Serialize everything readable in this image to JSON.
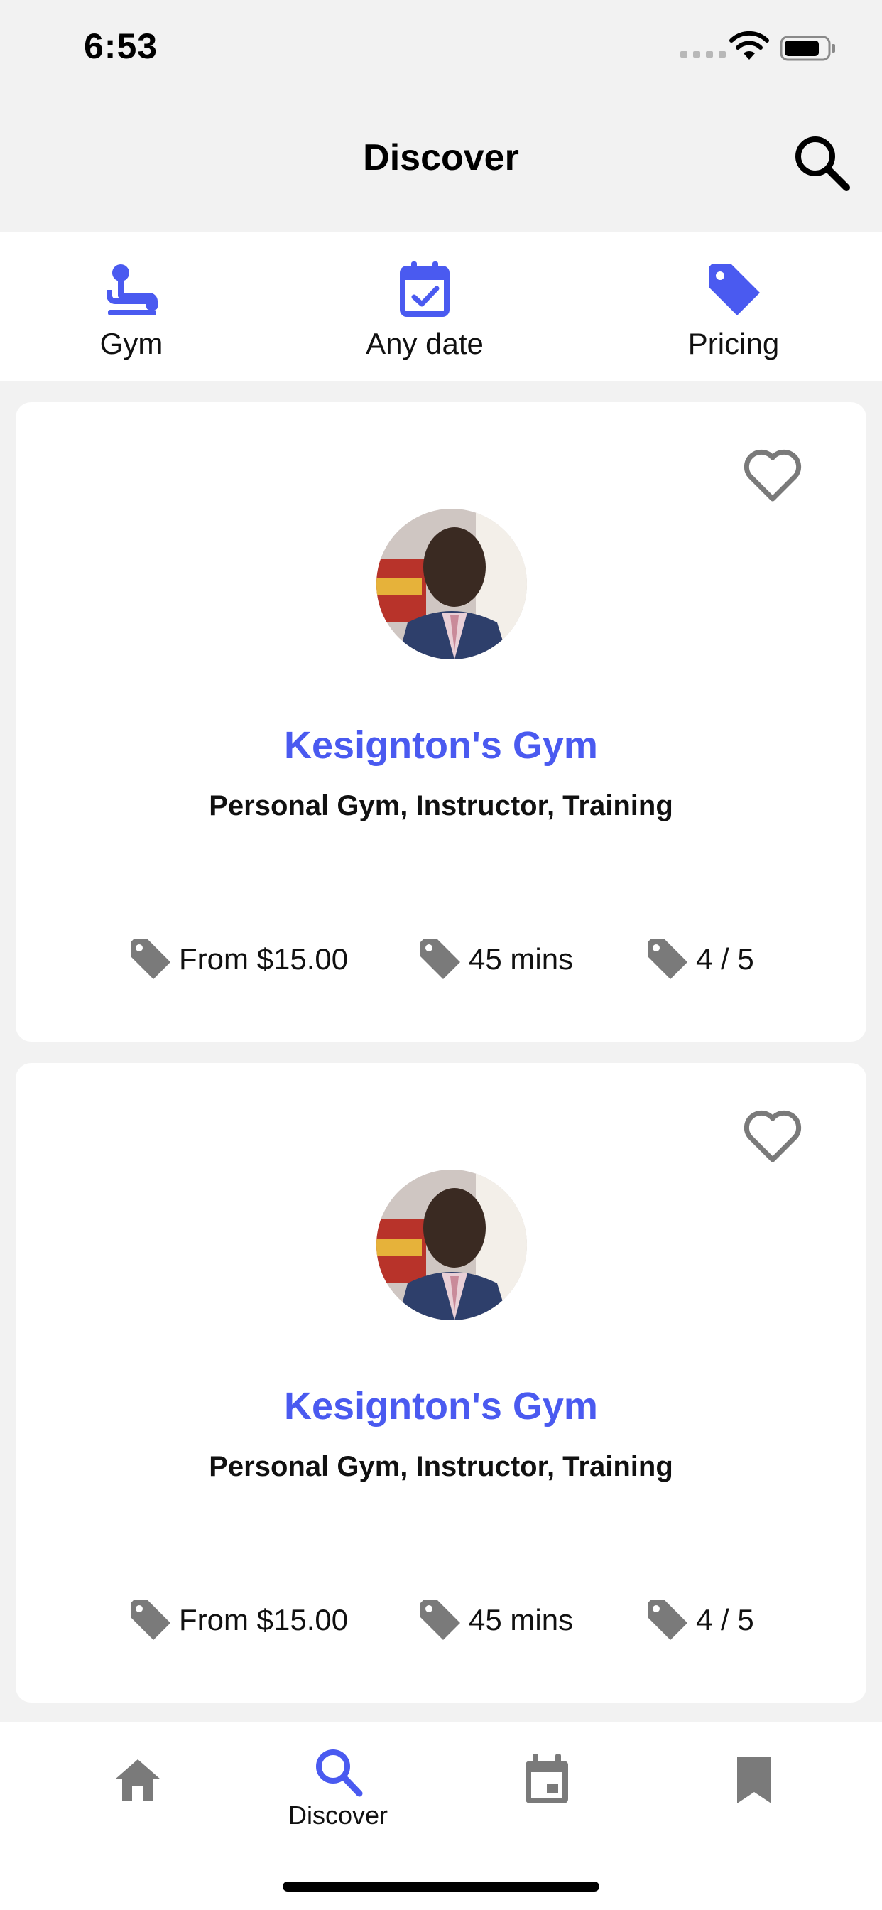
{
  "status_bar": {
    "time": "6:53"
  },
  "header": {
    "title": "Discover"
  },
  "filters": [
    {
      "label": "Gym",
      "icon": "gym-icon"
    },
    {
      "label": "Any date",
      "icon": "calendar-check-icon"
    },
    {
      "label": "Pricing",
      "icon": "price-tag-icon"
    }
  ],
  "cards": [
    {
      "name": "Kesignton's Gym",
      "tags": "Personal Gym, Instructor, Training",
      "price": "From $15.00",
      "duration": "45 mins",
      "rating": "4 / 5"
    },
    {
      "name": "Kesignton's Gym",
      "tags": "Personal Gym, Instructor, Training",
      "price": "From $15.00",
      "duration": "45 mins",
      "rating": "4 / 5"
    }
  ],
  "bottom_nav": {
    "items": [
      {
        "icon": "home-icon"
      },
      {
        "icon": "search-icon",
        "label": "Discover",
        "active": true
      },
      {
        "icon": "calendar-icon"
      },
      {
        "icon": "bookmark-icon"
      }
    ]
  },
  "colors": {
    "accent": "#4a5af0",
    "icon_grey": "#7a7a7a",
    "background": "#f2f2f2"
  }
}
